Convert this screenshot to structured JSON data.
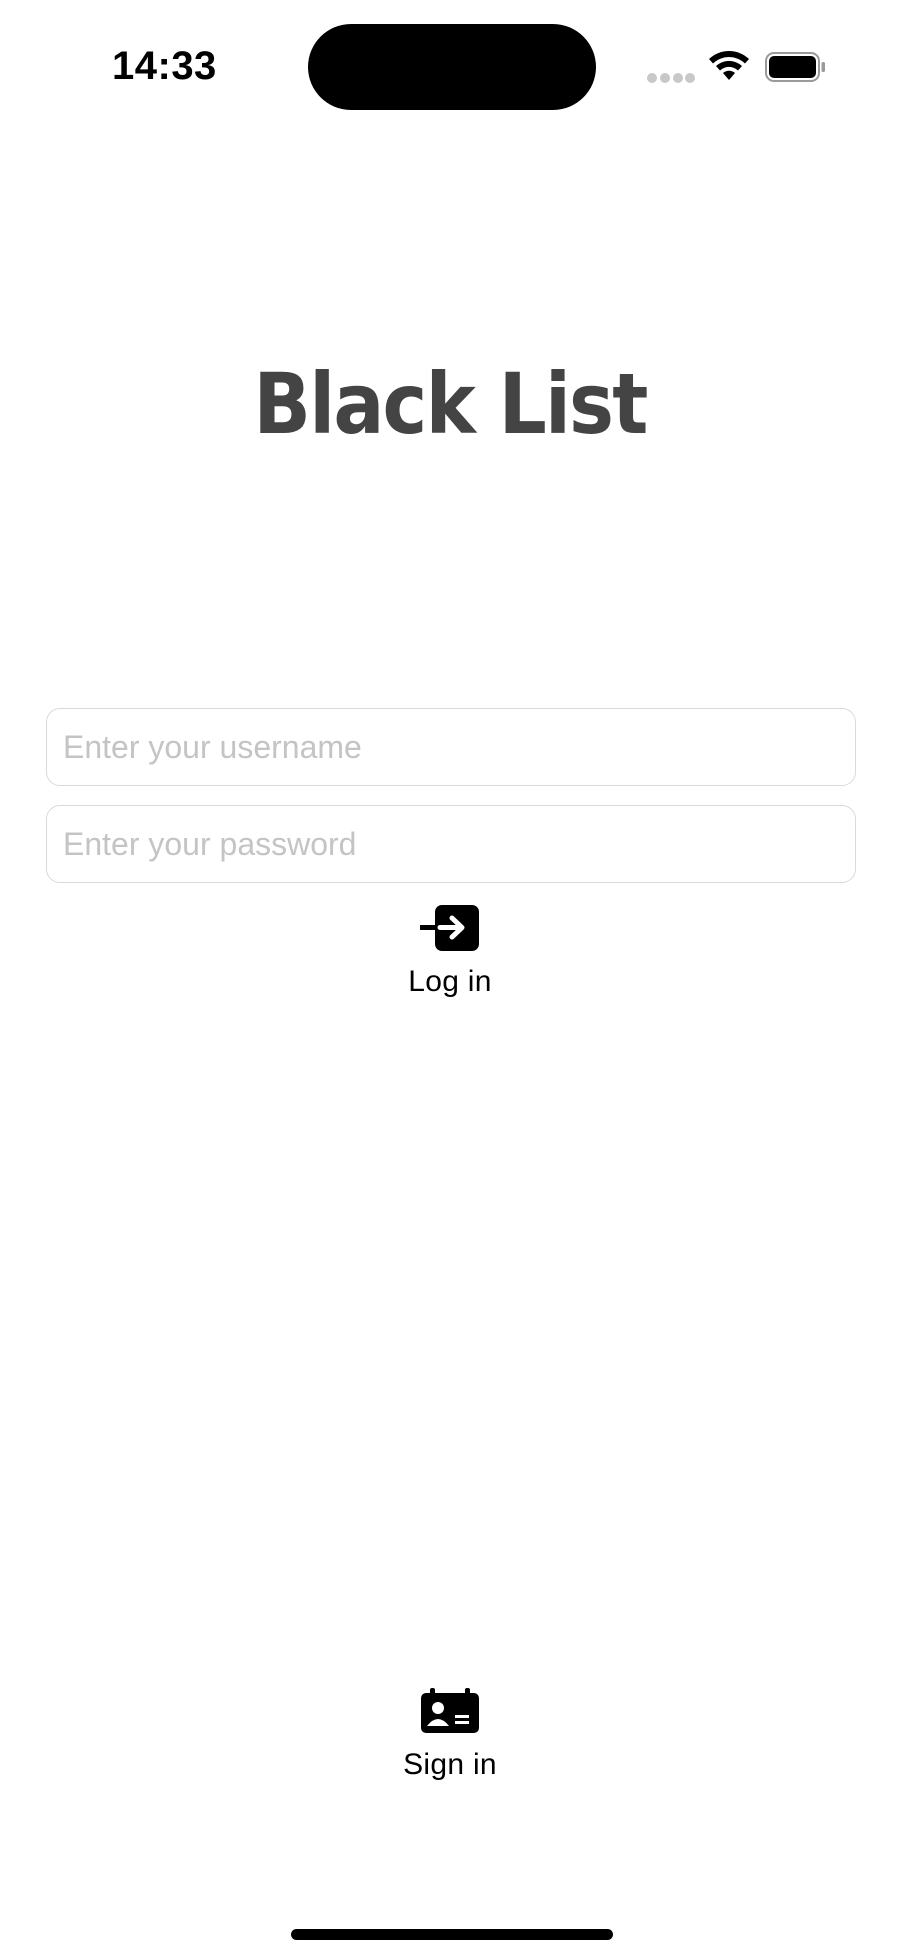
{
  "status_bar": {
    "time": "14:33",
    "icons": [
      "cellular-signal-icon",
      "wifi-icon",
      "battery-icon"
    ]
  },
  "app": {
    "title": "Black List"
  },
  "login_form": {
    "username_placeholder": "Enter your username",
    "username_value": "",
    "password_placeholder": "Enter your password",
    "password_value": ""
  },
  "actions": {
    "login_label": "Log in",
    "login_icon": "login-arrow-icon",
    "signin_label": "Sign in",
    "signin_icon": "id-card-icon"
  },
  "colors": {
    "title": "#444444",
    "background": "#ffffff",
    "field_border": "#dadada",
    "placeholder": "#c4c4c4"
  }
}
